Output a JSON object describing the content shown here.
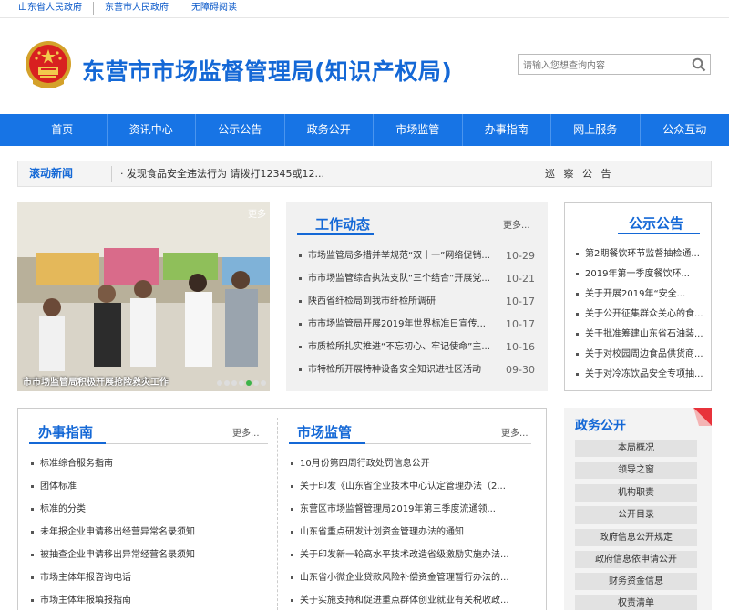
{
  "top_links": [
    "山东省人民政府",
    "东营市人民政府",
    "无障碍阅读"
  ],
  "site_title": "东营市市场监督管理局(知识产权局)",
  "search": {
    "placeholder": "请输入您想查询内容"
  },
  "nav": [
    "首页",
    "资讯中心",
    "公示公告",
    "政务公开",
    "市场监管",
    "办事指南",
    "网上服务",
    "公众互动"
  ],
  "ticker": {
    "label": "滚动新闻",
    "item": "· 发现食品安全违法行为 请拨打12345或12...",
    "right_item": "巡 察 公 告"
  },
  "photo": {
    "more": "更多",
    "caption": "市市场监管局积极开展抢险救灾工作",
    "slide_count": 7,
    "active_slide": 4
  },
  "work_news": {
    "title": "工作动态",
    "more": "更多...",
    "items": [
      {
        "text": "市场监管局多措并举规范“双十一”网络促销...",
        "date": "10-29"
      },
      {
        "text": "市市场监管综合执法支队“三个结合”开展党...",
        "date": "10-21"
      },
      {
        "text": "陕西省纤检局到我市纤检所调研",
        "date": "10-17"
      },
      {
        "text": "市市场监管局开展2019年世界标准日宣传...",
        "date": "10-17"
      },
      {
        "text": "市质检所扎实推进“不忘初心、牢记使命”主...",
        "date": "10-16"
      },
      {
        "text": "市特检所开展特种设备安全知识进社区活动",
        "date": "09-30"
      }
    ]
  },
  "notices": {
    "title": "公示公告",
    "items": [
      "第2期餐饮环节监督抽检通...",
      "2019年第一季度餐饮环...",
      "关于开展2019年“安全...",
      "关于公开征集群众关心的食...",
      "关于批准筹建山东省石油装...",
      "关于对校园周边食品供货商...",
      "关于对冷冻饮品安全专项抽..."
    ]
  },
  "guide": {
    "title": "办事指南",
    "more": "更多...",
    "items": [
      "标准综合服务指南",
      "团体标准",
      "标准的分类",
      "未年报企业申请移出经营异常名录须知",
      "被抽查企业申请移出异常经营名录须知",
      "市场主体年报咨询电话",
      "市场主体年报填报指南"
    ]
  },
  "supervision": {
    "title": "市场监管",
    "more": "更多...",
    "items": [
      "10月份第四周行政处罚信息公开",
      "关于印发《山东省企业技术中心认定管理办法（2...",
      "东营区市场监督管理局2019年第三季度流通领...",
      "山东省重点研发计划资金管理办法的通知",
      "关于印发新一轮高水平技术改造省级激励实施办法...",
      "山东省小微企业贷款风险补偿资金管理暂行办法的...",
      "关于实施支持和促进重点群体创业就业有关税收政..."
    ]
  },
  "gov_open": {
    "title": "政务公开",
    "items": [
      "本局概况",
      "领导之窗",
      "机构职责",
      "公开目录",
      "政府信息公开规定",
      "政府信息依申请公开",
      "财务资金信息",
      "权责清单"
    ]
  },
  "colors": {
    "brand_blue": "#1774e5",
    "title_blue": "#1468d6",
    "corner_red": "#e8333b"
  }
}
